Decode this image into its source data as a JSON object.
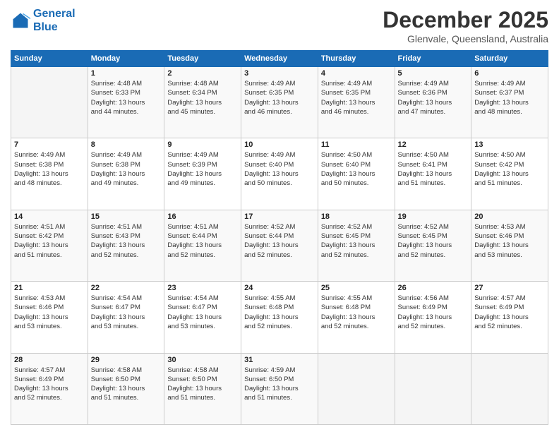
{
  "logo": {
    "line1": "General",
    "line2": "Blue"
  },
  "title": "December 2025",
  "location": "Glenvale, Queensland, Australia",
  "days_header": [
    "Sunday",
    "Monday",
    "Tuesday",
    "Wednesday",
    "Thursday",
    "Friday",
    "Saturday"
  ],
  "weeks": [
    [
      {
        "num": "",
        "info": ""
      },
      {
        "num": "1",
        "info": "Sunrise: 4:48 AM\nSunset: 6:33 PM\nDaylight: 13 hours\nand 44 minutes."
      },
      {
        "num": "2",
        "info": "Sunrise: 4:48 AM\nSunset: 6:34 PM\nDaylight: 13 hours\nand 45 minutes."
      },
      {
        "num": "3",
        "info": "Sunrise: 4:49 AM\nSunset: 6:35 PM\nDaylight: 13 hours\nand 46 minutes."
      },
      {
        "num": "4",
        "info": "Sunrise: 4:49 AM\nSunset: 6:35 PM\nDaylight: 13 hours\nand 46 minutes."
      },
      {
        "num": "5",
        "info": "Sunrise: 4:49 AM\nSunset: 6:36 PM\nDaylight: 13 hours\nand 47 minutes."
      },
      {
        "num": "6",
        "info": "Sunrise: 4:49 AM\nSunset: 6:37 PM\nDaylight: 13 hours\nand 48 minutes."
      }
    ],
    [
      {
        "num": "7",
        "info": "Sunrise: 4:49 AM\nSunset: 6:38 PM\nDaylight: 13 hours\nand 48 minutes."
      },
      {
        "num": "8",
        "info": "Sunrise: 4:49 AM\nSunset: 6:38 PM\nDaylight: 13 hours\nand 49 minutes."
      },
      {
        "num": "9",
        "info": "Sunrise: 4:49 AM\nSunset: 6:39 PM\nDaylight: 13 hours\nand 49 minutes."
      },
      {
        "num": "10",
        "info": "Sunrise: 4:49 AM\nSunset: 6:40 PM\nDaylight: 13 hours\nand 50 minutes."
      },
      {
        "num": "11",
        "info": "Sunrise: 4:50 AM\nSunset: 6:40 PM\nDaylight: 13 hours\nand 50 minutes."
      },
      {
        "num": "12",
        "info": "Sunrise: 4:50 AM\nSunset: 6:41 PM\nDaylight: 13 hours\nand 51 minutes."
      },
      {
        "num": "13",
        "info": "Sunrise: 4:50 AM\nSunset: 6:42 PM\nDaylight: 13 hours\nand 51 minutes."
      }
    ],
    [
      {
        "num": "14",
        "info": "Sunrise: 4:51 AM\nSunset: 6:42 PM\nDaylight: 13 hours\nand 51 minutes."
      },
      {
        "num": "15",
        "info": "Sunrise: 4:51 AM\nSunset: 6:43 PM\nDaylight: 13 hours\nand 52 minutes."
      },
      {
        "num": "16",
        "info": "Sunrise: 4:51 AM\nSunset: 6:44 PM\nDaylight: 13 hours\nand 52 minutes."
      },
      {
        "num": "17",
        "info": "Sunrise: 4:52 AM\nSunset: 6:44 PM\nDaylight: 13 hours\nand 52 minutes."
      },
      {
        "num": "18",
        "info": "Sunrise: 4:52 AM\nSunset: 6:45 PM\nDaylight: 13 hours\nand 52 minutes."
      },
      {
        "num": "19",
        "info": "Sunrise: 4:52 AM\nSunset: 6:45 PM\nDaylight: 13 hours\nand 52 minutes."
      },
      {
        "num": "20",
        "info": "Sunrise: 4:53 AM\nSunset: 6:46 PM\nDaylight: 13 hours\nand 53 minutes."
      }
    ],
    [
      {
        "num": "21",
        "info": "Sunrise: 4:53 AM\nSunset: 6:46 PM\nDaylight: 13 hours\nand 53 minutes."
      },
      {
        "num": "22",
        "info": "Sunrise: 4:54 AM\nSunset: 6:47 PM\nDaylight: 13 hours\nand 53 minutes."
      },
      {
        "num": "23",
        "info": "Sunrise: 4:54 AM\nSunset: 6:47 PM\nDaylight: 13 hours\nand 53 minutes."
      },
      {
        "num": "24",
        "info": "Sunrise: 4:55 AM\nSunset: 6:48 PM\nDaylight: 13 hours\nand 52 minutes."
      },
      {
        "num": "25",
        "info": "Sunrise: 4:55 AM\nSunset: 6:48 PM\nDaylight: 13 hours\nand 52 minutes."
      },
      {
        "num": "26",
        "info": "Sunrise: 4:56 AM\nSunset: 6:49 PM\nDaylight: 13 hours\nand 52 minutes."
      },
      {
        "num": "27",
        "info": "Sunrise: 4:57 AM\nSunset: 6:49 PM\nDaylight: 13 hours\nand 52 minutes."
      }
    ],
    [
      {
        "num": "28",
        "info": "Sunrise: 4:57 AM\nSunset: 6:49 PM\nDaylight: 13 hours\nand 52 minutes."
      },
      {
        "num": "29",
        "info": "Sunrise: 4:58 AM\nSunset: 6:50 PM\nDaylight: 13 hours\nand 51 minutes."
      },
      {
        "num": "30",
        "info": "Sunrise: 4:58 AM\nSunset: 6:50 PM\nDaylight: 13 hours\nand 51 minutes."
      },
      {
        "num": "31",
        "info": "Sunrise: 4:59 AM\nSunset: 6:50 PM\nDaylight: 13 hours\nand 51 minutes."
      },
      {
        "num": "",
        "info": ""
      },
      {
        "num": "",
        "info": ""
      },
      {
        "num": "",
        "info": ""
      }
    ]
  ]
}
